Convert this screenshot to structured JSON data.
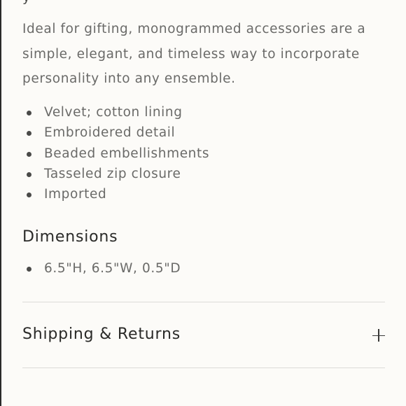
{
  "product": {
    "description": "Ideal for gifting, monogrammed accessories are a simple, elegant, and timeless way to incorporate personality into any ensemble.",
    "features": [
      "Velvet; cotton lining",
      "Embroidered detail",
      "Beaded embellishments",
      "Tasseled zip closure",
      "Imported"
    ],
    "dimensions_heading": "Dimensions",
    "dimensions": [
      "6.5\"H, 6.5\"W, 0.5\"D"
    ]
  },
  "accordion": {
    "shipping_label": "Shipping & Returns",
    "expand_icon": "plus-icon"
  }
}
